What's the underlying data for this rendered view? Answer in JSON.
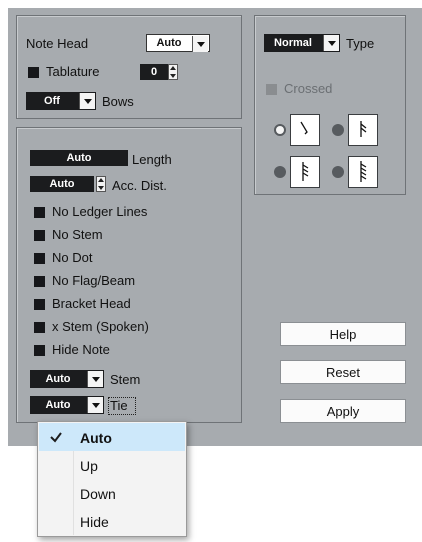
{
  "note_head": {
    "label": "Note Head",
    "value": "Auto"
  },
  "tablature": {
    "label": "Tablature",
    "value": "0"
  },
  "bows": {
    "label": "Bows",
    "value": "Off"
  },
  "type": {
    "label": "Type",
    "value": "Normal"
  },
  "crossed": {
    "label": "Crossed"
  },
  "length": {
    "label": "Length",
    "value": "Auto"
  },
  "acc_dist": {
    "label": "Acc. Dist.",
    "value": "Auto"
  },
  "checkboxes": [
    "No Ledger Lines",
    "No Stem",
    "No Dot",
    "No Flag/Beam",
    "Bracket Head",
    "x Stem (Spoken)",
    "Hide Note"
  ],
  "stem": {
    "label": "Stem",
    "value": "Auto"
  },
  "tie": {
    "label": "Tie",
    "value": "Auto"
  },
  "buttons": {
    "help": "Help",
    "reset": "Reset",
    "apply": "Apply"
  },
  "tie_menu": {
    "items": [
      "Auto",
      "Up",
      "Down",
      "Hide"
    ],
    "selected": "Auto",
    "check_icon": "checkmark-icon"
  },
  "colors": {
    "panel": "#a7abaf",
    "dark_field": "#1b1c1e",
    "menu_highlight": "#cde8fa",
    "check": "#1a73c8"
  }
}
